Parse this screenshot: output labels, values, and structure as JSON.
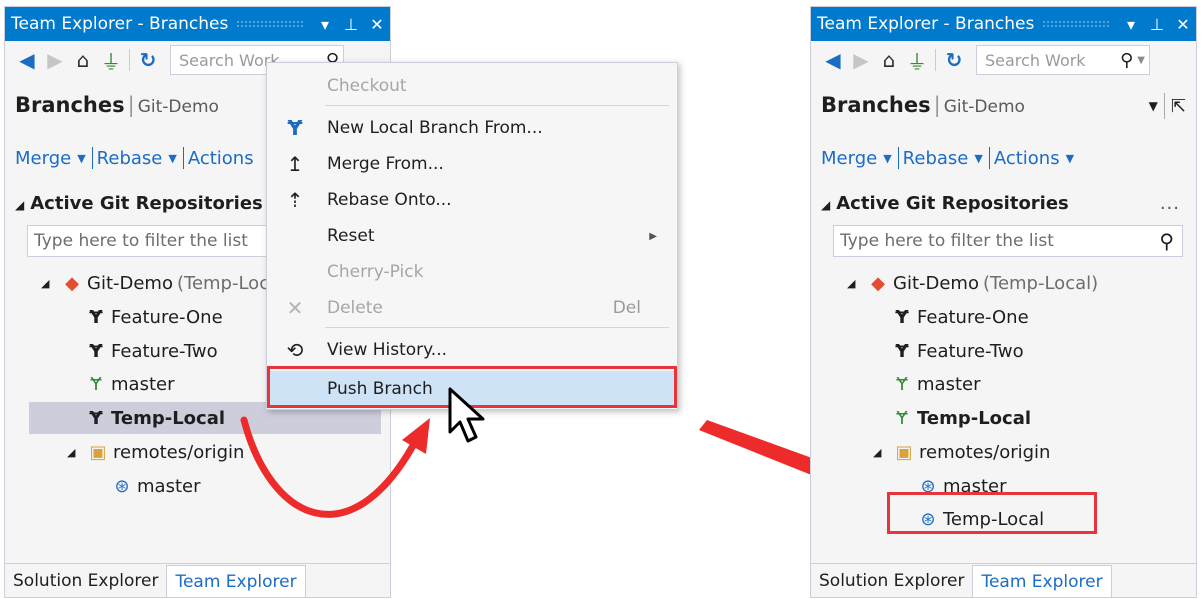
{
  "left_panel": {
    "title": "Team Explorer - Branches",
    "title_icons": [
      "dropdown-icon",
      "pin-icon",
      "close-icon"
    ],
    "search_placeholder": "Search Work",
    "header_title": "Branches",
    "header_repo": "Git-Demo",
    "actions": [
      "Merge",
      "Rebase",
      "Actions"
    ],
    "section_title": "Active Git Repositories",
    "filter_placeholder": "Type here to filter the list",
    "tree": [
      {
        "label": "Git-Demo",
        "suffix": "(Temp-Local)",
        "icon": "git-repo-icon",
        "level": 1,
        "expandable": true
      },
      {
        "label": "Feature-One",
        "icon": "branch-icon",
        "level": 2
      },
      {
        "label": "Feature-Two",
        "icon": "branch-icon",
        "level": 2
      },
      {
        "label": "master",
        "icon": "branch-published-icon",
        "level": 2
      },
      {
        "label": "Temp-Local",
        "icon": "branch-icon",
        "level": 2,
        "selected": true,
        "bold": true
      },
      {
        "label": "remotes/origin",
        "icon": "remote-folder-icon",
        "level": 2,
        "expandable": true
      },
      {
        "label": "master",
        "icon": "remote-branch-icon",
        "level": 3
      }
    ],
    "bottom_tabs": [
      "Solution Explorer",
      "Team Explorer"
    ],
    "active_tab": "Team Explorer"
  },
  "context_menu": {
    "items": [
      {
        "label": "Checkout",
        "disabled": true,
        "icon": ""
      },
      {
        "label": "New Local Branch From...",
        "icon": "new-branch-icon"
      },
      {
        "label": "Merge From...",
        "icon": "merge-icon"
      },
      {
        "label": "Rebase Onto...",
        "icon": "rebase-icon"
      },
      {
        "label": "Reset",
        "icon": "",
        "submenu": true
      },
      {
        "label": "Cherry-Pick",
        "disabled": true,
        "icon": ""
      },
      {
        "label": "Delete",
        "disabled": true,
        "icon": "delete-icon",
        "shortcut": "Del"
      },
      {
        "label": "View History...",
        "icon": "history-icon"
      },
      {
        "label": "Push Branch",
        "icon": "",
        "highlighted": true
      }
    ]
  },
  "right_panel": {
    "title": "Team Explorer - Branches",
    "search_placeholder": "Search Work",
    "header_title": "Branches",
    "header_repo": "Git-Demo",
    "actions": [
      "Merge",
      "Rebase",
      "Actions"
    ],
    "section_title": "Active Git Repositories",
    "more_label": "...",
    "filter_placeholder": "Type here to filter the list",
    "tree": [
      {
        "label": "Git-Demo",
        "suffix": "(Temp-Local)",
        "icon": "git-repo-icon",
        "level": 1,
        "expandable": true
      },
      {
        "label": "Feature-One",
        "icon": "branch-icon",
        "level": 2
      },
      {
        "label": "Feature-Two",
        "icon": "branch-icon",
        "level": 2
      },
      {
        "label": "master",
        "icon": "branch-published-icon",
        "level": 2
      },
      {
        "label": "Temp-Local",
        "icon": "branch-published-icon",
        "level": 2,
        "bold": true
      },
      {
        "label": "remotes/origin",
        "icon": "remote-folder-icon",
        "level": 2,
        "expandable": true
      },
      {
        "label": "master",
        "icon": "remote-branch-icon",
        "level": 3
      },
      {
        "label": "Temp-Local",
        "icon": "remote-branch-icon",
        "level": 3,
        "highlighted": true
      }
    ],
    "bottom_tabs": [
      "Solution Explorer",
      "Team Explorer"
    ],
    "active_tab": "Team Explorer"
  },
  "colors": {
    "accent": "#007acc",
    "link": "#1c6cc4",
    "highlight_box": "#e8343d",
    "arrow": "#ee2b2b"
  }
}
